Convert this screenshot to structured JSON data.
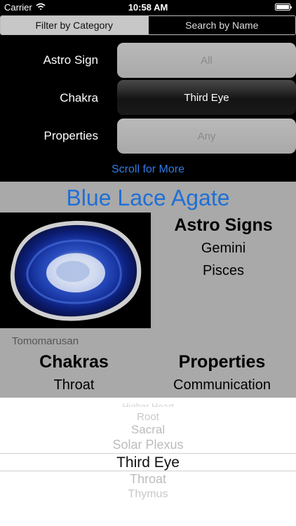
{
  "status_bar": {
    "carrier": "Carrier",
    "time": "10:58 AM"
  },
  "segmented_control": {
    "options": [
      "Filter by Category",
      "Search by Name"
    ],
    "selected_index": 0
  },
  "filters": [
    {
      "label": "Astro Sign",
      "value": "All",
      "style": "placeholder"
    },
    {
      "label": "Chakra",
      "value": "Third Eye",
      "style": "selected"
    },
    {
      "label": "Properties",
      "value": "Any",
      "style": "placeholder"
    }
  ],
  "scroll_hint": "Scroll for More",
  "stone": {
    "name": "Blue Lace Agate",
    "astro_heading": "Astro Signs",
    "astro_signs": [
      "Gemini",
      "Pisces"
    ],
    "image_credit": "Tomomarusan",
    "chakras_heading": "Chakras",
    "chakras": [
      "Throat"
    ],
    "properties_heading": "Properties",
    "properties": [
      "Communication"
    ]
  },
  "picker": {
    "items": [
      "Higher Heart",
      "Root",
      "Sacral",
      "Solar Plexus",
      "Third Eye",
      "Throat",
      "Thymus"
    ],
    "selected": "Third Eye"
  },
  "colors": {
    "accent": "#1f6fd6",
    "link": "#2f7ce6",
    "panel": "#a9a9a9"
  }
}
